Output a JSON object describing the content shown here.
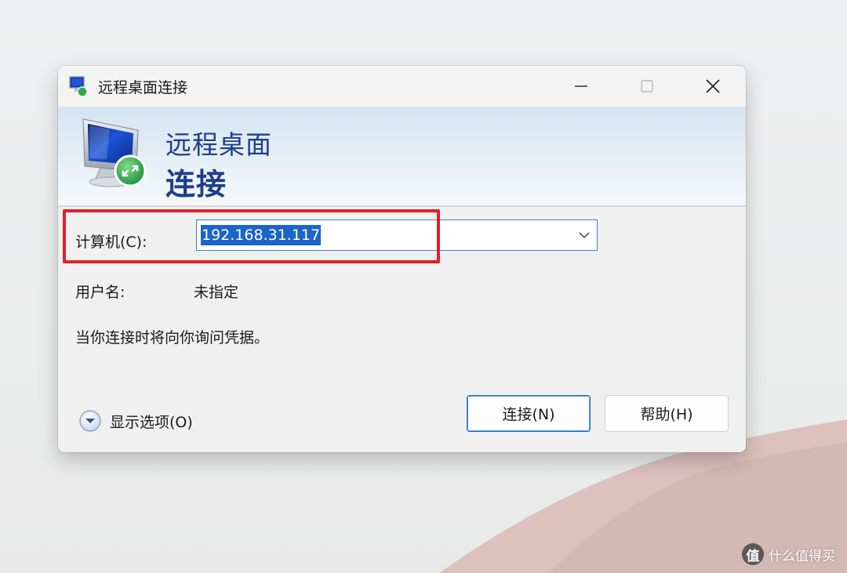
{
  "window": {
    "title": "远程桌面连接",
    "buttons": {
      "minimize": "minimize",
      "maximize": "maximize",
      "close": "close"
    }
  },
  "banner": {
    "line1": "远程桌面",
    "line2": "连接"
  },
  "form": {
    "computer_label": "计算机(C):",
    "computer_value": "192.168.31.117",
    "user_label": "用户名:",
    "user_value": "未指定",
    "info": "当你连接时将向你询问凭据。"
  },
  "footer": {
    "options_label": "显示选项(O)",
    "connect_label": "连接(N)",
    "help_label": "帮助(H)"
  },
  "watermark": {
    "logo": "值",
    "text": "什么值得买"
  },
  "colors": {
    "banner_text": "#1f3e8a",
    "highlight": "#e0202a",
    "selection": "#1b64c9",
    "accent": "#1d6cc8"
  },
  "icons": [
    "remote-desktop-icon",
    "minimize-icon",
    "maximize-icon",
    "close-icon",
    "chevron-down-icon",
    "expand-options-icon"
  ]
}
